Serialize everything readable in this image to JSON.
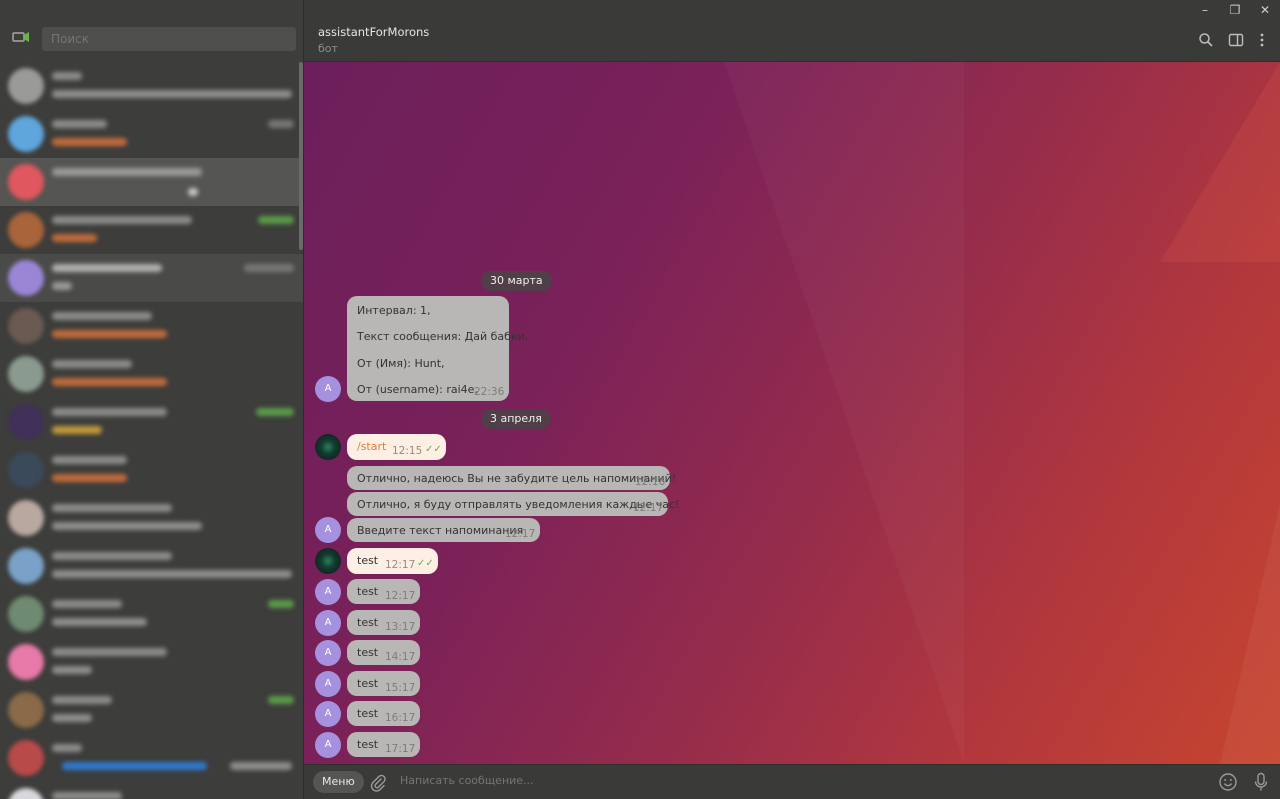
{
  "sidebar": {
    "search_placeholder": "Поиск"
  },
  "header": {
    "title": "assistantForMorons",
    "subtitle": "бот"
  },
  "window_controls": {
    "minimize": "–",
    "restore": "❐",
    "close": "✕"
  },
  "messages": {
    "date_1": "30 марта",
    "msg_interval_l1": "Интервал: 1,",
    "msg_interval_l2": "Текст сообщения: Дай бабки,",
    "msg_interval_l3": "От (Имя): Hunt,",
    "msg_interval_l4": "От (username): rai4e,",
    "msg_interval_time": "22:36",
    "date_2": "3 апреля",
    "start_text": "/start",
    "start_time": "12:15",
    "reply1_text": "Отлично, надеюсь Вы не забудите цель напоминаний!",
    "reply1_time": "12:16",
    "reply2_text": "Отлично, я буду отправлять уведомления каждые час!",
    "reply2_time": "12:17",
    "reply3_text": "Введите текст напоминания",
    "reply3_time": "12:17",
    "user_test_text": "test",
    "user_test_time": "12:17",
    "bot_tests": [
      {
        "text": "test",
        "time": "12:17"
      },
      {
        "text": "test",
        "time": "13:17"
      },
      {
        "text": "test",
        "time": "14:17"
      },
      {
        "text": "test",
        "time": "15:17"
      },
      {
        "text": "test",
        "time": "16:17"
      },
      {
        "text": "test",
        "time": "17:17"
      }
    ],
    "bot_avatar_letter": "A"
  },
  "input": {
    "menu_label": "Меню",
    "placeholder": "Написать сообщение..."
  },
  "colors": {
    "accent_check": "#63b24a",
    "bot_avatar": "#a591de",
    "bubble_in": "#b8b7b5",
    "bubble_out": "#fdefe3"
  }
}
